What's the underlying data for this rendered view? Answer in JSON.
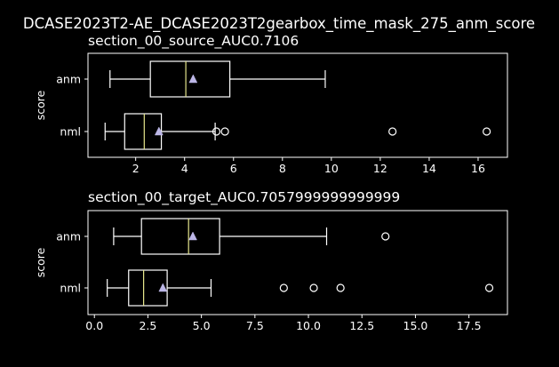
{
  "suptitle": "DCASE2023T2-AE_DCASE2023T2gearbox_time_mask_275_anm_score",
  "style": {
    "background": "#000000",
    "foreground": "#ffffff",
    "median_color": "#e6e68c",
    "mean_marker_color": "#bcb6e6"
  },
  "chart_data": [
    {
      "type": "box",
      "orientation": "horizontal",
      "title": "section_00_source_AUC0.7106",
      "ylabel": "score",
      "xlabel": "",
      "xlim": [
        0.05,
        17.2
      ],
      "xticks": [
        2,
        4,
        6,
        8,
        10,
        12,
        14,
        16
      ],
      "xtick_labels": [
        "2",
        "4",
        "6",
        "8",
        "10",
        "12",
        "14",
        "16"
      ],
      "grid": false,
      "categories": [
        "anm",
        "nml"
      ],
      "boxes": [
        {
          "label": "anm",
          "whisker_low": 0.95,
          "q1": 2.6,
          "median": 4.05,
          "q3": 5.85,
          "whisker_high": 9.75,
          "mean": 4.35,
          "outliers": []
        },
        {
          "label": "nml",
          "whisker_low": 0.75,
          "q1": 1.55,
          "median": 2.35,
          "q3": 3.05,
          "whisker_high": 5.25,
          "mean": 2.95,
          "outliers": [
            5.3,
            5.65,
            12.5,
            16.35
          ]
        }
      ]
    },
    {
      "type": "box",
      "orientation": "horizontal",
      "title": "section_00_target_AUC0.7057999999999999",
      "ylabel": "score",
      "xlabel": "",
      "xlim": [
        -0.3,
        19.3
      ],
      "xticks": [
        0.0,
        2.5,
        5.0,
        7.5,
        10.0,
        12.5,
        15.0,
        17.5
      ],
      "xtick_labels": [
        "0.0",
        "2.5",
        "5.0",
        "7.5",
        "10.0",
        "12.5",
        "15.0",
        "17.5"
      ],
      "grid": false,
      "categories": [
        "anm",
        "nml"
      ],
      "boxes": [
        {
          "label": "anm",
          "whisker_low": 0.9,
          "q1": 2.2,
          "median": 4.4,
          "q3": 5.85,
          "whisker_high": 10.85,
          "mean": 4.6,
          "outliers": [
            13.6
          ]
        },
        {
          "label": "nml",
          "whisker_low": 0.6,
          "q1": 1.6,
          "median": 2.3,
          "q3": 3.4,
          "whisker_high": 5.45,
          "mean": 3.2,
          "outliers": [
            8.85,
            10.25,
            11.5,
            18.45
          ]
        }
      ]
    }
  ]
}
